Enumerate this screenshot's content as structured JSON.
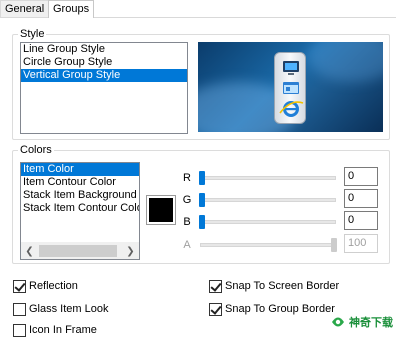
{
  "tabs": [
    {
      "label": "General",
      "active": false
    },
    {
      "label": "Groups",
      "active": true
    }
  ],
  "style_group": {
    "title": "Style",
    "items": [
      "Line Group Style",
      "Circle Group Style",
      "Vertical Group Style"
    ],
    "selected_index": 2
  },
  "colors_group": {
    "title": "Colors",
    "items": [
      "Item Color",
      "Item Contour Color",
      "Stack Item Background",
      "Stack Item Contour Color"
    ],
    "selected_index": 0,
    "swatch_color": "#000000",
    "sliders": [
      {
        "label": "R",
        "value": "0",
        "level": 0,
        "enabled": true
      },
      {
        "label": "G",
        "value": "0",
        "level": 0,
        "enabled": true
      },
      {
        "label": "B",
        "value": "0",
        "level": 0,
        "enabled": true
      },
      {
        "label": "A",
        "value": "100",
        "level": 1,
        "enabled": false
      }
    ]
  },
  "options": {
    "reflection": {
      "label": "Reflection",
      "checked": true
    },
    "glass_item_look": {
      "label": "Glass Item Look",
      "checked": false
    },
    "icon_in_frame": {
      "label": "Icon In Frame",
      "checked": false
    },
    "snap_to_screen_border": {
      "label": "Snap To Screen Border",
      "checked": true
    },
    "snap_to_group_border": {
      "label": "Snap To Group Border",
      "checked": true
    }
  },
  "watermark_text": "神奇下载",
  "accent_color": "#0078d7",
  "preview_icons": [
    "monitor-icon",
    "window-icon",
    "internet-explorer-icon"
  ]
}
